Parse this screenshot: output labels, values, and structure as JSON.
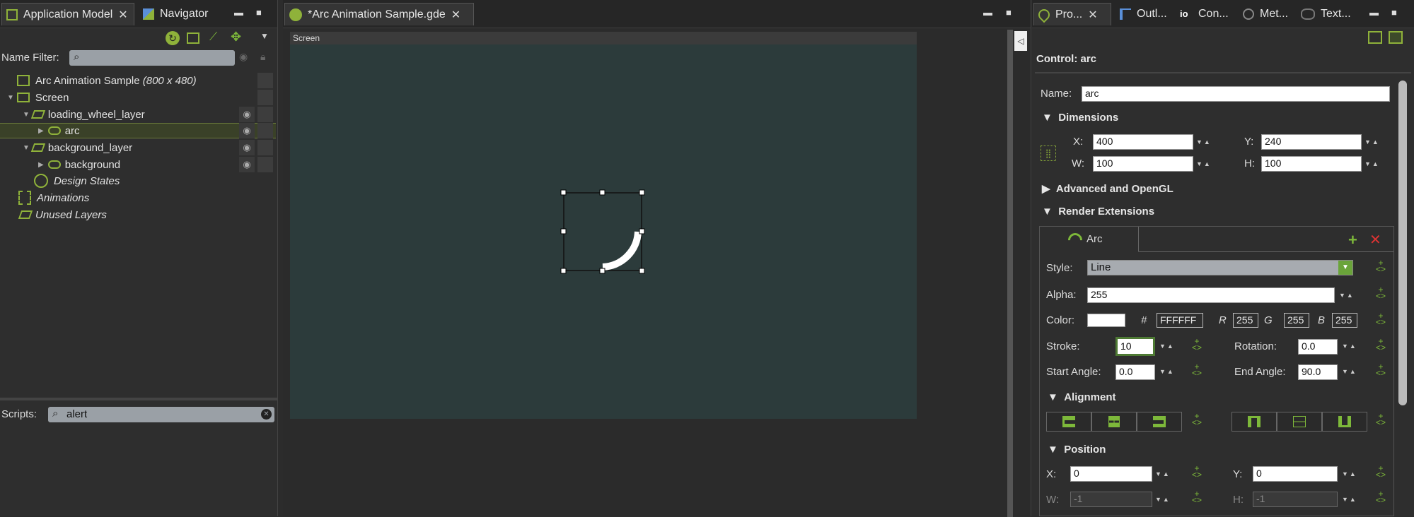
{
  "left_panel": {
    "tabs": [
      {
        "label": "Application Model"
      },
      {
        "label": "Navigator"
      }
    ],
    "name_filter_label": "Name Filter:",
    "tree": {
      "root": "Arc Animation Sample",
      "root_suffix": "(800 x 480)",
      "screen": "Screen",
      "loading_wheel_layer": "loading_wheel_layer",
      "arc": "arc",
      "background_layer": "background_layer",
      "background": "background",
      "design_states": "Design States",
      "animations": "Animations",
      "unused_layers": "Unused Layers"
    },
    "scripts_label": "Scripts:",
    "scripts_value": "alert"
  },
  "editor": {
    "tab_label": "*Arc Animation Sample.gde",
    "screen_label": "Screen"
  },
  "right_panel": {
    "tabs": [
      {
        "label": "Pro..."
      },
      {
        "label": "Outl..."
      },
      {
        "label": "Con..."
      },
      {
        "label": "Met..."
      },
      {
        "label": "Text..."
      }
    ],
    "control_title": "Control: arc",
    "name_label": "Name:",
    "name_value": "arc",
    "dimensions": {
      "title": "Dimensions",
      "x_label": "X:",
      "x_value": "400",
      "y_label": "Y:",
      "y_value": "240",
      "w_label": "W:",
      "w_value": "100",
      "h_label": "H:",
      "h_value": "100"
    },
    "advanced_title": "Advanced and OpenGL",
    "render_ext_title": "Render Extensions",
    "arc": {
      "tab_label": "Arc",
      "style_label": "Style:",
      "style_value": "Line",
      "alpha_label": "Alpha:",
      "alpha_value": "255",
      "color_label": "Color:",
      "hash": "#",
      "hex_value": "FFFFFF",
      "r_label": "R",
      "r_value": "255",
      "g_label": "G",
      "g_value": "255",
      "b_label": "B",
      "b_value": "255",
      "stroke_label": "Stroke:",
      "stroke_value": "10",
      "rotation_label": "Rotation:",
      "rotation_value": "0.0",
      "start_label": "Start Angle:",
      "start_value": "0.0",
      "end_label": "End Angle:",
      "end_value": "90.0",
      "alignment_title": "Alignment",
      "position_title": "Position",
      "px_label": "X:",
      "px_value": "0",
      "py_label": "Y:",
      "py_value": "0",
      "pw_label": "W:",
      "pw_value": "-1",
      "ph_label": "H:",
      "ph_value": "-1"
    }
  },
  "colors": {
    "accent": "#7db83a",
    "canvas": "#2c3b3b",
    "selection": "#3a4128"
  }
}
